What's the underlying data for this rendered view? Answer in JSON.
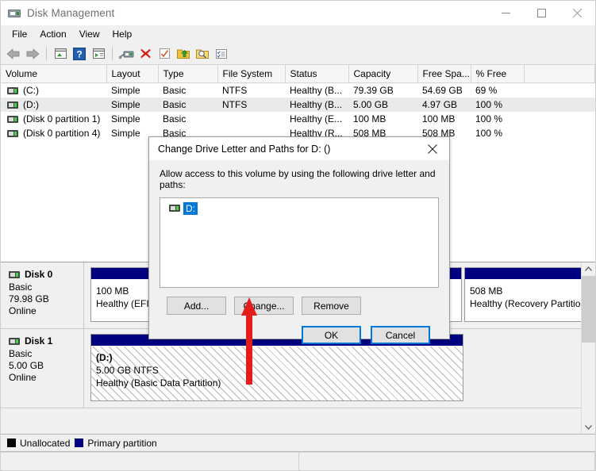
{
  "window": {
    "title": "Disk Management",
    "icon": "disk-drive-icon",
    "controls": {
      "minimize": "minimize",
      "maximize": "maximize",
      "close": "close"
    }
  },
  "menubar": {
    "items": [
      "File",
      "Action",
      "View",
      "Help"
    ]
  },
  "toolbar": {
    "items": [
      {
        "name": "back-icon",
        "label": "Back"
      },
      {
        "name": "forward-icon",
        "label": "Forward"
      },
      {
        "name": "separator-1",
        "label": ""
      },
      {
        "name": "up-one-level-icon",
        "label": "Up One Level"
      },
      {
        "name": "help-icon",
        "label": "Help"
      },
      {
        "name": "show-hide-console-tree-icon",
        "label": "Show/Hide Console Tree"
      },
      {
        "name": "separator-2",
        "label": ""
      },
      {
        "name": "rescan-disks-icon",
        "label": "Rescan Disks"
      },
      {
        "name": "delete-icon",
        "label": "Delete"
      },
      {
        "name": "properties-icon",
        "label": "Properties"
      },
      {
        "name": "export-list-icon",
        "label": "Export List"
      },
      {
        "name": "search-icon",
        "label": "Search"
      },
      {
        "name": "list-view-icon",
        "label": "List View"
      }
    ]
  },
  "volume_list": {
    "columns": [
      "Volume",
      "Layout",
      "Type",
      "File System",
      "Status",
      "Capacity",
      "Free Spa...",
      "% Free"
    ],
    "rows": [
      {
        "volume": "(C:)",
        "layout": "Simple",
        "type": "Basic",
        "fs": "NTFS",
        "status": "Healthy (B...",
        "capacity": "79.39 GB",
        "free": "54.69 GB",
        "pct": "69 %",
        "selected": false
      },
      {
        "volume": "(D:)",
        "layout": "Simple",
        "type": "Basic",
        "fs": "NTFS",
        "status": "Healthy (B...",
        "capacity": "5.00 GB",
        "free": "4.97 GB",
        "pct": "100 %",
        "selected": true
      },
      {
        "volume": "(Disk 0 partition 1)",
        "layout": "Simple",
        "type": "Basic",
        "fs": "",
        "status": "Healthy (E...",
        "capacity": "100 MB",
        "free": "100 MB",
        "pct": "100 %",
        "selected": false
      },
      {
        "volume": "(Disk 0 partition 4)",
        "layout": "Simple",
        "type": "Basic",
        "fs": "",
        "status": "Healthy (R...",
        "capacity": "508 MB",
        "free": "508 MB",
        "pct": "100 %",
        "selected": false
      }
    ]
  },
  "disks": [
    {
      "name": "Disk 0",
      "type": "Basic",
      "size": "79.98 GB",
      "state": "Online",
      "partitions": [
        {
          "label": "",
          "size": "100 MB",
          "status": "Healthy (EFI S",
          "hatched": false
        },
        {
          "label": "",
          "size": "508 MB",
          "status": "Healthy (Recovery Partition)",
          "hatched": false
        }
      ]
    },
    {
      "name": "Disk 1",
      "type": "Basic",
      "size": "5.00 GB",
      "state": "Online",
      "partitions": [
        {
          "label": "(D:)",
          "size": "5.00 GB NTFS",
          "status": "Healthy (Basic Data Partition)",
          "hatched": true
        }
      ]
    }
  ],
  "legend": [
    {
      "swatch": "#000000",
      "label": "Unallocated"
    },
    {
      "swatch": "#000080",
      "label": "Primary partition"
    }
  ],
  "dialog": {
    "title": "Change Drive Letter and Paths for D: ()",
    "instruction": "Allow access to this volume by using the following drive letter and paths:",
    "list_items": [
      {
        "text": "D:",
        "selected": true
      }
    ],
    "buttons": {
      "add": "Add...",
      "change": "Change...",
      "remove": "Remove",
      "ok": "OK",
      "cancel": "Cancel"
    },
    "accent_color": "#0078d7"
  },
  "annotation": {
    "arrow": {
      "color": "#e41c1c",
      "points_to": "change-button"
    }
  },
  "statusbar": {
    "cells": [
      "",
      "",
      ""
    ]
  }
}
